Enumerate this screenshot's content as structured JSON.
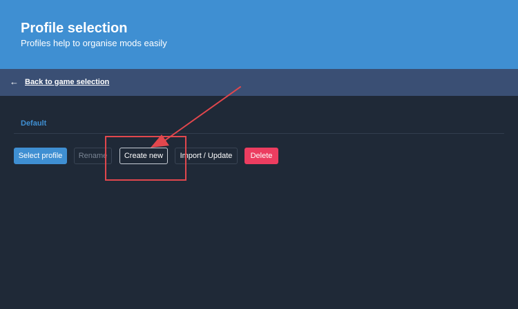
{
  "header": {
    "title": "Profile selection",
    "subtitle": "Profiles help to organise mods easily"
  },
  "nav": {
    "back_icon": "arrow-left-icon",
    "back_label": "Back to game selection"
  },
  "profiles": {
    "items": [
      "Default"
    ]
  },
  "actions": {
    "select_label": "Select profile",
    "rename_label": "Rename",
    "create_label": "Create new",
    "import_label": "Import / Update",
    "delete_label": "Delete"
  },
  "colors": {
    "header_bg": "#3f8fd2",
    "nav_bg": "#3a4f74",
    "page_bg": "#1f2937",
    "primary": "#3f8fd2",
    "danger": "#ec3d60",
    "annotation": "#e2474d"
  }
}
